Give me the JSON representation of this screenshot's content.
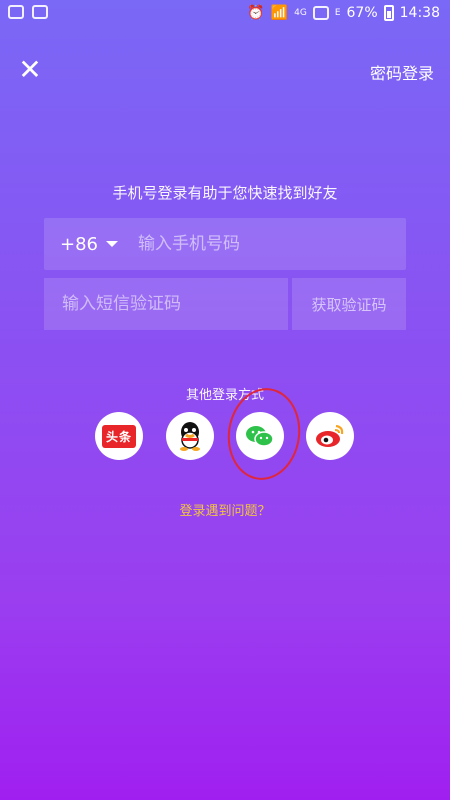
{
  "status_bar": {
    "network_4g": "4G",
    "network_e": "E",
    "battery": "67%",
    "time": "14:38"
  },
  "header": {
    "close_icon": "close-icon",
    "password_login": "密码登录"
  },
  "hint": "手机号登录有助于您快速找到好友",
  "phone": {
    "country_code": "+86",
    "placeholder": "输入手机号码"
  },
  "sms": {
    "placeholder": "输入短信验证码",
    "get_code": "获取验证码"
  },
  "other_login": {
    "title": "其他登录方式",
    "providers": [
      {
        "name": "toutiao",
        "badge": "头条",
        "icon": "toutiao-icon"
      },
      {
        "name": "qq",
        "icon": "qq-penguin-icon"
      },
      {
        "name": "wechat",
        "icon": "wechat-icon"
      },
      {
        "name": "weibo",
        "icon": "weibo-icon"
      }
    ]
  },
  "trouble_link": "登录遇到问题？",
  "colors": {
    "gradient_top": "#7a68f6",
    "gradient_bottom": "#a01ff0",
    "link": "#f2c343",
    "annotation": "#e0263a"
  }
}
